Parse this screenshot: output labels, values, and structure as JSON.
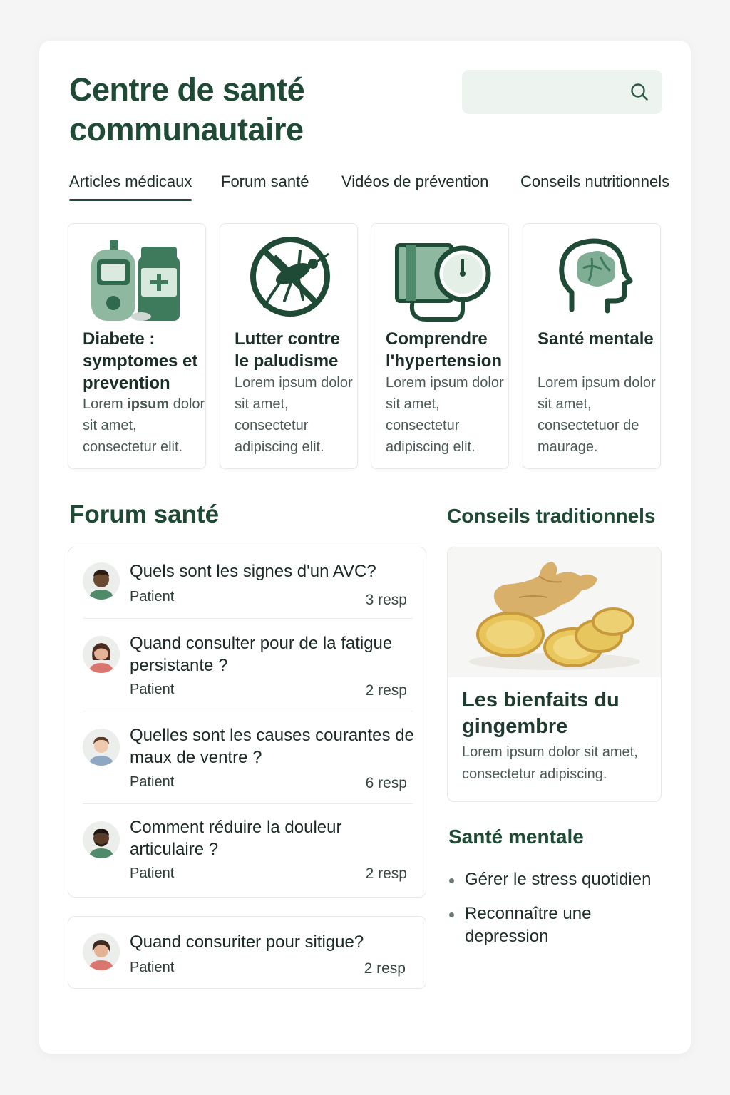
{
  "header": {
    "title": "Centre de santé communautaire",
    "search_placeholder": ""
  },
  "tabs": [
    {
      "label": "Articles médicaux",
      "active": true
    },
    {
      "label": "Forum santé",
      "active": false
    },
    {
      "label": "Vidéos de prévention",
      "active": false
    },
    {
      "label": "Conseils nutritionnels",
      "active": false
    }
  ],
  "articles": [
    {
      "title": "Diabete : symptomes et prevention",
      "desc_pre": "Lorem ",
      "desc_bold": "ipsum",
      "desc_post": " dolor sit amet, consectetur elit.",
      "icon": "diabetes-kit-icon"
    },
    {
      "title": "Lutter contre le paludisme",
      "desc": "Lorem ipsum dolor sit amet, consectetur adipiscing elit.",
      "icon": "no-mosquito-icon"
    },
    {
      "title": "Comprendre l'hypertension",
      "desc": "Lorem ipsum dolor sit amet, consectetur adipiscing elit.",
      "icon": "blood-pressure-monitor-icon"
    },
    {
      "title": "Santé mentale",
      "desc": "Lorem ipsum dolor sit amet, consectetuor de maurage.",
      "icon": "head-brain-icon"
    }
  ],
  "forum": {
    "title": "Forum santé",
    "posts": [
      {
        "question": "Quels sont les signes d'un AVC?",
        "author": "Patient",
        "replies": "3 resp"
      },
      {
        "question": "Quand consulter pour de la fatigue persistante ?",
        "author": "Patient",
        "replies": "2 resp"
      },
      {
        "question": "Quelles sont les causes courantes de maux de ventre ?",
        "author": "Patient",
        "replies": "6 resp"
      },
      {
        "question": "Comment réduire la douleur articulaire ?",
        "author": "Patient",
        "replies": "2 resp"
      },
      {
        "question": "Quand consuriter pour sitigue?",
        "author": "Patient",
        "replies": "2 resp"
      }
    ]
  },
  "traditional": {
    "title": "Conseils traditionnels",
    "card_title": "Les bienfaits du gingembre",
    "card_desc": "Lorem ipsum dolor sit amet, consectetur adipiscing."
  },
  "mental_health": {
    "title": "Santé mentale",
    "items": [
      "Gérer le stress quotidien",
      "Reconnaître une depression"
    ]
  },
  "colors": {
    "primary": "#1f4a36",
    "accent": "#4f8a6a",
    "accent_light": "#edf4ef"
  }
}
